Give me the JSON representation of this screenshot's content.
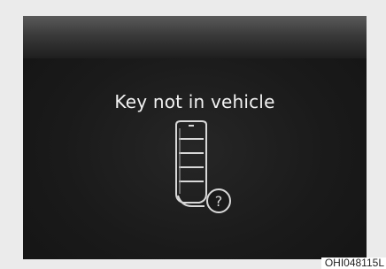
{
  "display": {
    "message": "Key not in vehicle",
    "icon": "smart-key-question-icon"
  },
  "figure": {
    "code": "OHI048115L"
  },
  "colors": {
    "screen_background": "#1a1a1a",
    "text": "#f2f2f2",
    "icon_stroke": "#d8d8d8"
  }
}
